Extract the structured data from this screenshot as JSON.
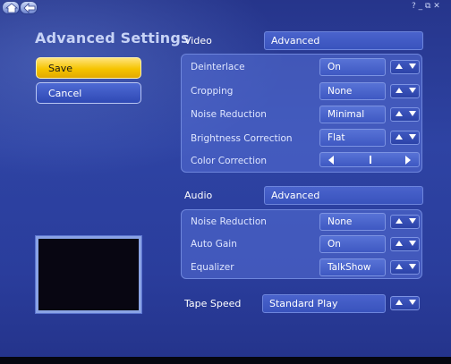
{
  "window": {
    "home_icon": "home-icon",
    "back_icon": "back-arrow-icon",
    "controls": "? _ ⧉ ✕"
  },
  "title": "Advanced Settings",
  "actions": {
    "save_label": "Save",
    "cancel_label": "Cancel"
  },
  "video": {
    "label": "Video",
    "mode": "Advanced",
    "rows": [
      {
        "label": "Deinterlace",
        "value": "On"
      },
      {
        "label": "Cropping",
        "value": "None"
      },
      {
        "label": "Noise Reduction",
        "value": "Minimal"
      },
      {
        "label": "Brightness Correction",
        "value": "Flat"
      }
    ],
    "color_correction": {
      "label": "Color Correction",
      "level": 0.5
    }
  },
  "audio": {
    "label": "Audio",
    "mode": "Advanced",
    "rows": [
      {
        "label": "Noise Reduction",
        "value": "None"
      },
      {
        "label": "Auto Gain",
        "value": "On"
      },
      {
        "label": "Equalizer",
        "value": "TalkShow"
      }
    ]
  },
  "tape_speed": {
    "label": "Tape Speed",
    "value": "Standard Play"
  },
  "colors": {
    "background": "#2a3a8e",
    "accent_save": "#f6c400",
    "panel": "#5670d6"
  }
}
